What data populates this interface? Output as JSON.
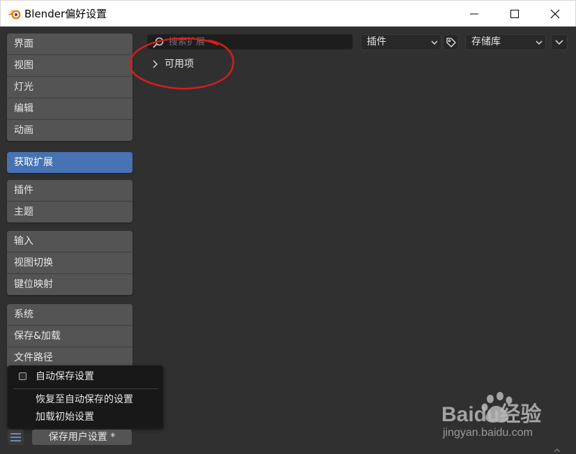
{
  "window": {
    "title": "Blender偏好设置",
    "brand_color": "#e87d0d"
  },
  "sidebar": {
    "groups": [
      {
        "items": [
          {
            "label": "界面"
          },
          {
            "label": "视图"
          },
          {
            "label": "灯光"
          },
          {
            "label": "编辑"
          },
          {
            "label": "动画"
          }
        ]
      },
      {
        "items": [
          {
            "label": "获取扩展",
            "active": true
          }
        ]
      },
      {
        "items": [
          {
            "label": "插件"
          },
          {
            "label": "主题"
          }
        ]
      },
      {
        "items": [
          {
            "label": "输入"
          },
          {
            "label": "视图切换"
          },
          {
            "label": "键位映射"
          }
        ]
      },
      {
        "items": [
          {
            "label": "系统"
          },
          {
            "label": "保存&加载"
          },
          {
            "label": "文件路径"
          }
        ]
      }
    ],
    "active_color": "#4772b3"
  },
  "toolbar": {
    "search_placeholder": "搜索扩展",
    "type_filter": "插件",
    "repository": "存储库"
  },
  "content": {
    "available_label": "可用项"
  },
  "popup_menu": {
    "auto_save_label": "自动保存设置",
    "auto_save_checked": false,
    "revert_label": "恢复至自动保存的设置",
    "load_defaults_label": "加载初始设置"
  },
  "footer": {
    "save_label": "保存用户设置 *"
  },
  "watermark": {
    "brand": "Baidu经验",
    "url": "jingyan.baidu.com"
  },
  "annotation_color": "#d91c1c"
}
